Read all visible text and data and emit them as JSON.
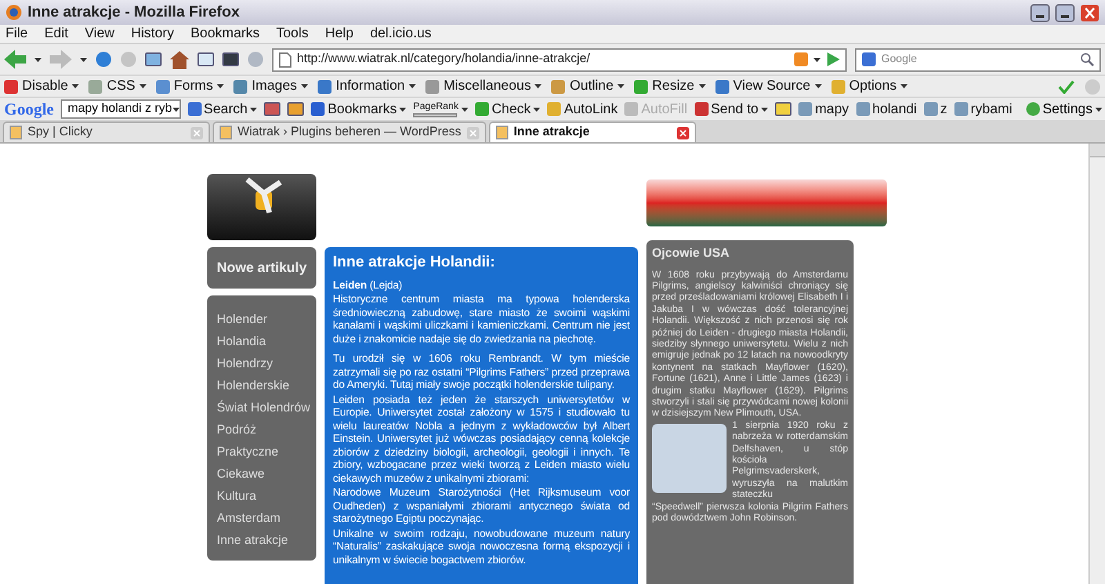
{
  "window": {
    "title": "Inne atrakcje - Mozilla Firefox"
  },
  "menu": [
    "File",
    "Edit",
    "View",
    "History",
    "Bookmarks",
    "Tools",
    "Help",
    "del.icio.us"
  ],
  "nav": {
    "url": "http://www.wiatrak.nl/category/holandia/inne-atrakcje/",
    "search_placeholder": "Google"
  },
  "devbar": [
    {
      "label": "Disable",
      "menu": true
    },
    {
      "label": "CSS",
      "menu": true
    },
    {
      "label": "Forms",
      "menu": true
    },
    {
      "label": "Images",
      "menu": true
    },
    {
      "label": "Information",
      "menu": true
    },
    {
      "label": "Miscellaneous",
      "menu": true
    },
    {
      "label": "Outline",
      "menu": true
    },
    {
      "label": "Resize",
      "menu": true
    },
    {
      "label": "View Source",
      "menu": true
    },
    {
      "label": "Options",
      "menu": true
    }
  ],
  "googlebar": {
    "logo": "Google",
    "query": "mapy holandi z ryb",
    "search": "Search",
    "bookmarks": "Bookmarks",
    "pagerank": "PageRank",
    "check": "Check",
    "autolink": "AutoLink",
    "autofill": {
      "label": "AutoFill",
      "disabled": true
    },
    "sendto": "Send to",
    "terms": [
      "mapy",
      "holandi",
      "z",
      "rybami"
    ],
    "settings": "Settings"
  },
  "tabs": [
    {
      "label": "Spy | Clicky",
      "selected": false
    },
    {
      "label": "Wiatrak › Plugins beheren — WordPress",
      "selected": false
    },
    {
      "label": "Inne atrakcje",
      "selected": true
    }
  ],
  "page": {
    "sidebar": {
      "heading": "Nowe artikuly",
      "items": [
        "Holender",
        "Holandia",
        "Holendrzy",
        "Holenderskie",
        "Świat Holendrów",
        "Podróż",
        "Praktyczne",
        "Ciekawe",
        "Kultura",
        "Amsterdam",
        "Inne atrakcje"
      ]
    },
    "article": {
      "title": "Inne atrakcje Holandii:",
      "sections": [
        [
          "**Leiden** (Lejda)",
          "Historyczne centrum miasta ma typowa holenderska średniowieczną zabudowę, stare miasto że swoimi wąskimi kanałami i wąskimi uliczkami i kamieniczkami. Centrum nie jest duże i znakomicie nadaje się do zwiedzania na piechotę."
        ],
        [
          "Tu urodził się w 1606 roku Rembrandt. W tym mieście zatrzymali się po raz ostatni “Pilgrims Fathers” przed przeprawa do Ameryki. Tutaj miały swoje początki holenderskie tulipany.",
          "Leiden posiada też jeden że starszych uniwersytetów w Europie. Uniwersytet został założony w 1575 i studiowało tu wielu laureatów Nobla a jednym z wykładowców był Albert Einstein. Uniwersytet już wówczas posiadający cenną kolekcje zbiorów z dziedziny biologii, archeologii, geologii i innych. Te zbiory, wzbogacane przez wieki tworzą z Leiden miasto wielu ciekawych muzeów z unikalnymi zbiorami:",
          "Narodowe Muzeum Starożytności (Het Rijksmuseum voor Oudheden) z wspaniałymi zbiorami antycznego świata od starożytnego Egiptu poczynając.",
          "Unikalne w swoim rodzaju, nowobudowane muzeum natury “Naturalis” zaskakujące swoja nowoczesna formą ekspozycji i unikalnym w świecie bogactwem zbiorów."
        ]
      ]
    },
    "aside": {
      "title": "Ojcowie USA",
      "paragraphs": [
        "W 1608 roku przybywają do Amsterdamu Pilgrims, angielscy kalwiniści chroniący się przed prześladowaniami królowej Elisabeth I i Jakuba I w wówczas dość tolerancyjnej Holandii. Większość z nich przenosi się rok później do Leiden - drugiego miasta Holandii, siedziby słynnego uniwersytetu. Wielu z nich emigruje jednak po 12 latach na nowoodkryty kontynent na statkach Mayflower (1620), Fortune (1621), Anne i Little James (1623) i drugim statku Mayflower (1629). Pilgrims stworzyli i stali się przywódcami nowej kolonii w dzisiejszym New Plimouth, USA.",
        "1 sierpnia 1920 roku z nabrzeża w rotterdamskim Delfshaven, u stóp kościoła Pelgrimsvaderskerk, wyruszyła na malutkim stateczku",
        "“Speedwell” pierwsza kolonia Pilgrim Fathers pod dowództwem John Robinson."
      ]
    }
  }
}
